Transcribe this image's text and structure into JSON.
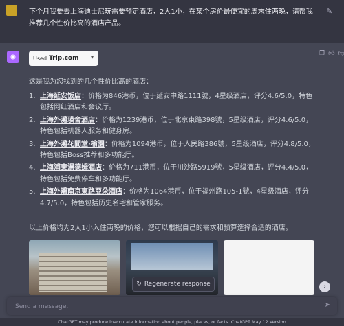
{
  "user_message": "下个月我要去上海迪士尼玩需要预定酒店，2大1小，在某个房价最便宜的周末住两晚，请帮我推荐几个性价比高的酒店产品。",
  "plugin": {
    "used_label": "Used",
    "brand": "Trip.com"
  },
  "response": {
    "intro": "这是我为您找到的几个性价比高的酒店：",
    "hotels": [
      {
        "num": "1.",
        "name": "上海延安饭店",
        "desc": "：价格为846港币，位于延安中路1111號，4星级酒店，评分4.6/5.0，特色包括网红酒店和会议厅。"
      },
      {
        "num": "2.",
        "name": "上海外灘瑛舍酒店",
        "desc": "：价格为1239港币，位于北京東路398號，5星级酒店，评分4.6/5.0，特色包括机器人服务和健身房。"
      },
      {
        "num": "3.",
        "name": "上海外灘花間堂·榆園",
        "desc": "：价格为1094港币，位于人民路386號，5星级酒店，评分4.8/5.0，特色包括Boss推荐和多功能厅。"
      },
      {
        "num": "4.",
        "name": "上海浦東湯德姆酒店",
        "desc": "：价格为711港币，位于川沙路5919號，5星级酒店，评分4.4/5.0，特色包括免费停车和多功能厅。"
      },
      {
        "num": "5.",
        "name": "上海外灘南京東路亞朵酒店",
        "desc": "：价格为1064港币，位于福州路105-1號，4星级酒店，评分4.7/5.0，特色包括历史名宅和管家服务。"
      }
    ],
    "summary": "以上价格均为2大1小入住两晚的价格，您可以根据自己的需求和预算选择合适的酒店。"
  },
  "regenerate_label": "Regenerate response",
  "composer": {
    "placeholder": "Send a message."
  },
  "footer": "ChatGPT may produce inaccurate information about people, places, or facts. ChatGPT May 12 Version",
  "icons": [
    "edit-icon",
    "copy-icon",
    "thumbs-up-icon",
    "thumbs-down-icon",
    "regenerate-icon",
    "chevron-right-icon",
    "send-icon",
    "chevron-down-icon"
  ]
}
